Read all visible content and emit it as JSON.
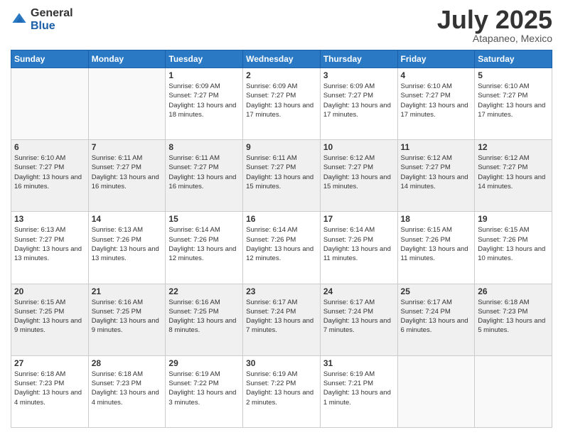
{
  "logo": {
    "general": "General",
    "blue": "Blue"
  },
  "header": {
    "month": "July 2025",
    "location": "Atapaneo, Mexico"
  },
  "weekdays": [
    "Sunday",
    "Monday",
    "Tuesday",
    "Wednesday",
    "Thursday",
    "Friday",
    "Saturday"
  ],
  "weeks": [
    [
      {
        "day": "",
        "empty": true
      },
      {
        "day": "",
        "empty": true
      },
      {
        "day": "1",
        "sunrise": "6:09 AM",
        "sunset": "7:27 PM",
        "daylight": "13 hours and 18 minutes."
      },
      {
        "day": "2",
        "sunrise": "6:09 AM",
        "sunset": "7:27 PM",
        "daylight": "13 hours and 17 minutes."
      },
      {
        "day": "3",
        "sunrise": "6:09 AM",
        "sunset": "7:27 PM",
        "daylight": "13 hours and 17 minutes."
      },
      {
        "day": "4",
        "sunrise": "6:10 AM",
        "sunset": "7:27 PM",
        "daylight": "13 hours and 17 minutes."
      },
      {
        "day": "5",
        "sunrise": "6:10 AM",
        "sunset": "7:27 PM",
        "daylight": "13 hours and 17 minutes."
      }
    ],
    [
      {
        "day": "6",
        "sunrise": "6:10 AM",
        "sunset": "7:27 PM",
        "daylight": "13 hours and 16 minutes."
      },
      {
        "day": "7",
        "sunrise": "6:11 AM",
        "sunset": "7:27 PM",
        "daylight": "13 hours and 16 minutes."
      },
      {
        "day": "8",
        "sunrise": "6:11 AM",
        "sunset": "7:27 PM",
        "daylight": "13 hours and 16 minutes."
      },
      {
        "day": "9",
        "sunrise": "6:11 AM",
        "sunset": "7:27 PM",
        "daylight": "13 hours and 15 minutes."
      },
      {
        "day": "10",
        "sunrise": "6:12 AM",
        "sunset": "7:27 PM",
        "daylight": "13 hours and 15 minutes."
      },
      {
        "day": "11",
        "sunrise": "6:12 AM",
        "sunset": "7:27 PM",
        "daylight": "13 hours and 14 minutes."
      },
      {
        "day": "12",
        "sunrise": "6:12 AM",
        "sunset": "7:27 PM",
        "daylight": "13 hours and 14 minutes."
      }
    ],
    [
      {
        "day": "13",
        "sunrise": "6:13 AM",
        "sunset": "7:27 PM",
        "daylight": "13 hours and 13 minutes."
      },
      {
        "day": "14",
        "sunrise": "6:13 AM",
        "sunset": "7:26 PM",
        "daylight": "13 hours and 13 minutes."
      },
      {
        "day": "15",
        "sunrise": "6:14 AM",
        "sunset": "7:26 PM",
        "daylight": "13 hours and 12 minutes."
      },
      {
        "day": "16",
        "sunrise": "6:14 AM",
        "sunset": "7:26 PM",
        "daylight": "13 hours and 12 minutes."
      },
      {
        "day": "17",
        "sunrise": "6:14 AM",
        "sunset": "7:26 PM",
        "daylight": "13 hours and 11 minutes."
      },
      {
        "day": "18",
        "sunrise": "6:15 AM",
        "sunset": "7:26 PM",
        "daylight": "13 hours and 11 minutes."
      },
      {
        "day": "19",
        "sunrise": "6:15 AM",
        "sunset": "7:26 PM",
        "daylight": "13 hours and 10 minutes."
      }
    ],
    [
      {
        "day": "20",
        "sunrise": "6:15 AM",
        "sunset": "7:25 PM",
        "daylight": "13 hours and 9 minutes."
      },
      {
        "day": "21",
        "sunrise": "6:16 AM",
        "sunset": "7:25 PM",
        "daylight": "13 hours and 9 minutes."
      },
      {
        "day": "22",
        "sunrise": "6:16 AM",
        "sunset": "7:25 PM",
        "daylight": "13 hours and 8 minutes."
      },
      {
        "day": "23",
        "sunrise": "6:17 AM",
        "sunset": "7:24 PM",
        "daylight": "13 hours and 7 minutes."
      },
      {
        "day": "24",
        "sunrise": "6:17 AM",
        "sunset": "7:24 PM",
        "daylight": "13 hours and 7 minutes."
      },
      {
        "day": "25",
        "sunrise": "6:17 AM",
        "sunset": "7:24 PM",
        "daylight": "13 hours and 6 minutes."
      },
      {
        "day": "26",
        "sunrise": "6:18 AM",
        "sunset": "7:23 PM",
        "daylight": "13 hours and 5 minutes."
      }
    ],
    [
      {
        "day": "27",
        "sunrise": "6:18 AM",
        "sunset": "7:23 PM",
        "daylight": "13 hours and 4 minutes."
      },
      {
        "day": "28",
        "sunrise": "6:18 AM",
        "sunset": "7:23 PM",
        "daylight": "13 hours and 4 minutes."
      },
      {
        "day": "29",
        "sunrise": "6:19 AM",
        "sunset": "7:22 PM",
        "daylight": "13 hours and 3 minutes."
      },
      {
        "day": "30",
        "sunrise": "6:19 AM",
        "sunset": "7:22 PM",
        "daylight": "13 hours and 2 minutes."
      },
      {
        "day": "31",
        "sunrise": "6:19 AM",
        "sunset": "7:21 PM",
        "daylight": "13 hours and 1 minute."
      },
      {
        "day": "",
        "empty": true
      },
      {
        "day": "",
        "empty": true
      }
    ]
  ]
}
